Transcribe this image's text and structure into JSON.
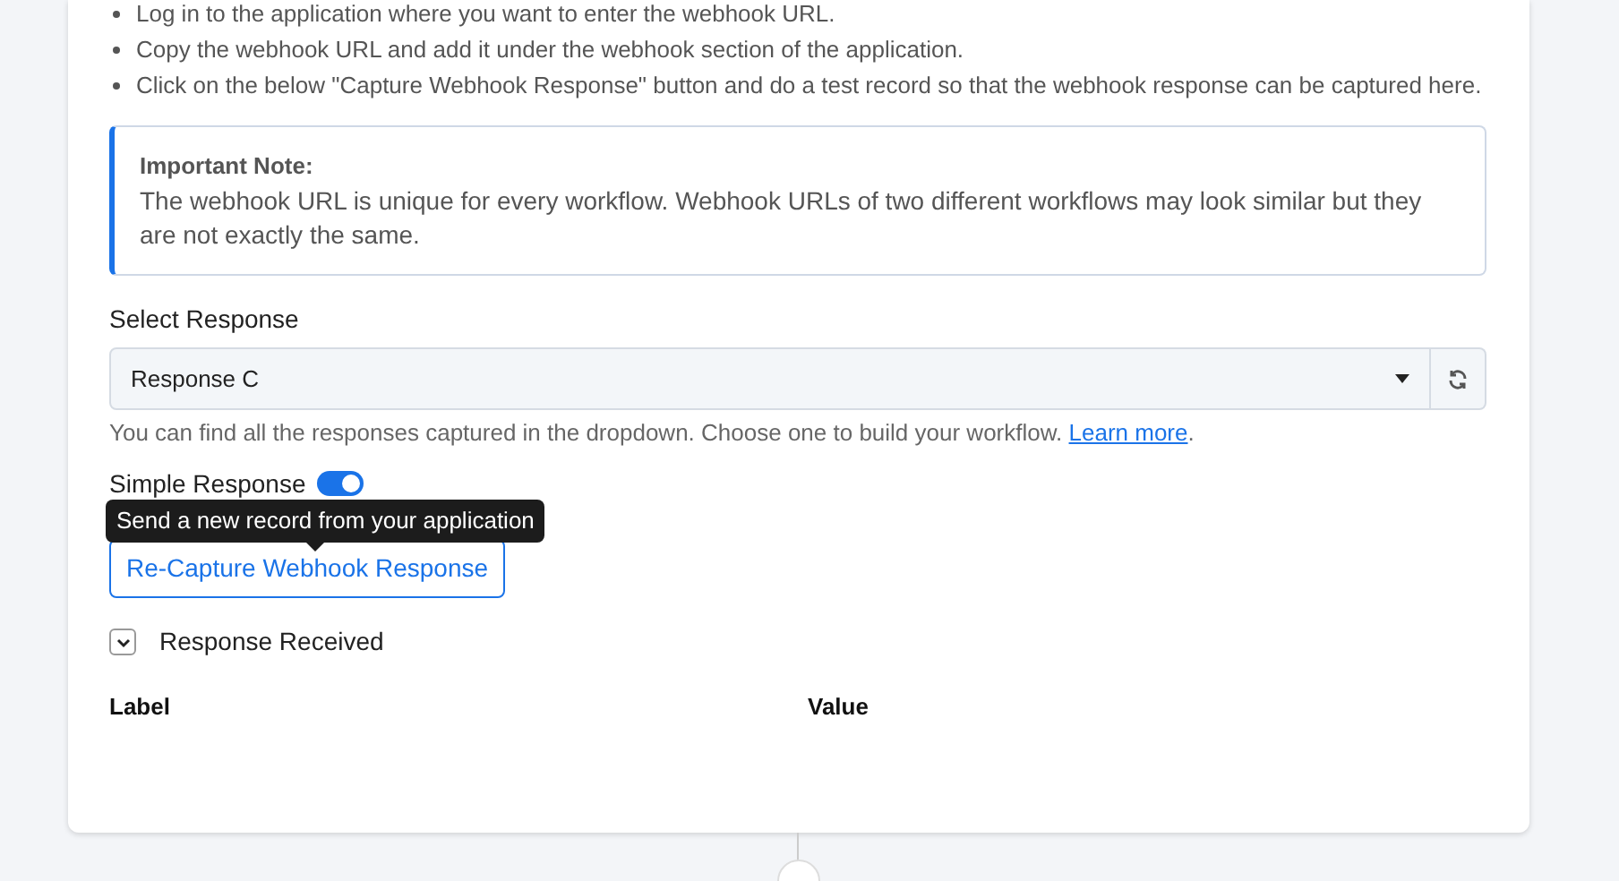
{
  "instructions": [
    "Log in to the application where you want to enter the webhook URL.",
    "Copy the webhook URL and add it under the webhook section of the application.",
    "Click on the below \"Capture Webhook Response\" button and do a test record so that the webhook response can be captured here."
  ],
  "note": {
    "title": "Important Note:",
    "text": "The webhook URL is unique for every workflow. Webhook URLs of two different workflows may look similar but they are not exactly the same."
  },
  "select_response": {
    "label": "Select Response",
    "value": "Response C",
    "help": "You can find all the responses captured in the dropdown. Choose one to build your workflow.",
    "help_link": "Learn more",
    "help_end": "."
  },
  "simple_response": {
    "label": "Simple Response",
    "on": true
  },
  "tooltip": "Send a new record from your application",
  "recapture_button": "Re-Capture Webhook Response",
  "response_received": {
    "label": "Response Received",
    "expanded": true
  },
  "columns": [
    "Label",
    "Value"
  ]
}
